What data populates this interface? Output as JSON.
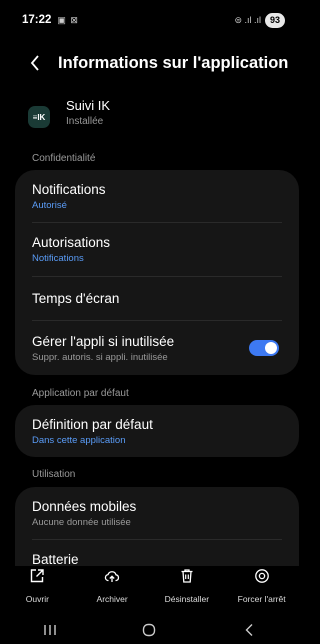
{
  "status_bar": {
    "time": "17:22",
    "left_icons": "▣ ⊠",
    "right_icons": "⊜ .ıl .ıl",
    "battery": "93"
  },
  "header": {
    "title": "Informations sur l'application"
  },
  "app": {
    "name": "Suivi IK",
    "status": "Installée",
    "icon_text": "≡IK"
  },
  "sections": {
    "privacy": "Confidentialité",
    "default_app": "Application par défaut",
    "usage": "Utilisation"
  },
  "privacy_items": {
    "notifications": {
      "title": "Notifications",
      "subtitle": "Autorisé"
    },
    "permissions": {
      "title": "Autorisations",
      "subtitle": "Notifications"
    },
    "screen_time": {
      "title": "Temps d'écran"
    },
    "manage_unused": {
      "title": "Gérer l'appli si inutilisée",
      "subtitle": "Suppr. autoris. si appli. inutilisée",
      "toggle_on": true
    }
  },
  "default_items": {
    "set_default": {
      "title": "Définition par défaut",
      "subtitle": "Dans cette application"
    }
  },
  "usage_items": {
    "mobile_data": {
      "title": "Données mobiles",
      "subtitle": "Aucune donnée utilisée"
    },
    "battery": {
      "title": "Batterie"
    }
  },
  "actions": {
    "open": "Ouvrir",
    "archive": "Archiver",
    "uninstall": "Désinstaller",
    "force_stop": "Forcer l'arrêt"
  },
  "colors": {
    "accent": "#3d79f2",
    "link": "#5a9cf7",
    "card": "#161616",
    "background": "#000000"
  }
}
